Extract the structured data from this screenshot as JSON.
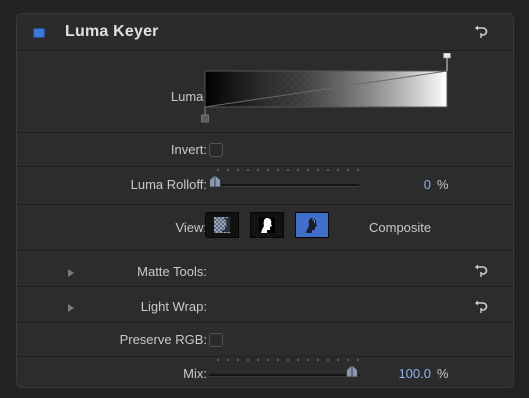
{
  "panel": {
    "title": "Luma Keyer",
    "enabled": true,
    "accent_color": "#3d79d9"
  },
  "luma": {
    "label": "Luma:"
  },
  "invert": {
    "label": "Invert:",
    "checked": false
  },
  "luma_rolloff": {
    "label": "Luma Rolloff:",
    "value": "0",
    "unit": "%"
  },
  "view": {
    "label": "View:",
    "options": [
      "matte-checker-icon",
      "silhouette-matte-icon",
      "composite-icon"
    ],
    "selected_index": 2,
    "selected_label": "Composite"
  },
  "matte_tools": {
    "label": "Matte Tools:"
  },
  "light_wrap": {
    "label": "Light Wrap:"
  },
  "preserve_rgb": {
    "label": "Preserve RGB:",
    "checked": false
  },
  "mix": {
    "label": "Mix:",
    "value": "100.0",
    "unit": "%",
    "fraction": 1.0
  }
}
